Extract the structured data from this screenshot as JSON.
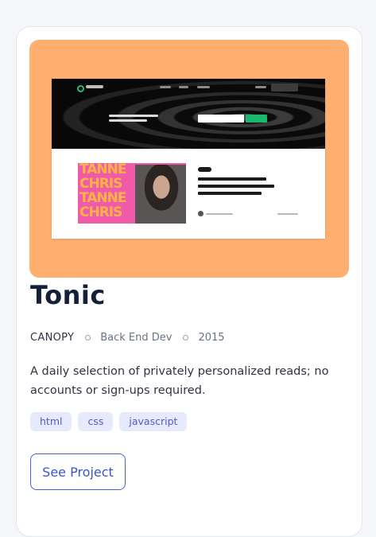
{
  "project": {
    "title": "Tonic",
    "company": "CANOPY",
    "role": "Back End Dev",
    "year": "2015",
    "description": "A daily selection of privately personalized reads; no accounts or sign-ups required.",
    "tags": [
      "html",
      "css",
      "javascript"
    ],
    "cta_label": "See Project"
  },
  "thumbnail": {
    "background_color": "#ffb070",
    "banner_words": [
      "TANNE",
      "CHRIS",
      "TANNE",
      "CHRIS"
    ],
    "icons": [
      "logo-icon"
    ]
  },
  "colors": {
    "accent": "#3b55cc",
    "chip_bg": "#e7eafd",
    "title": "#14203a"
  }
}
